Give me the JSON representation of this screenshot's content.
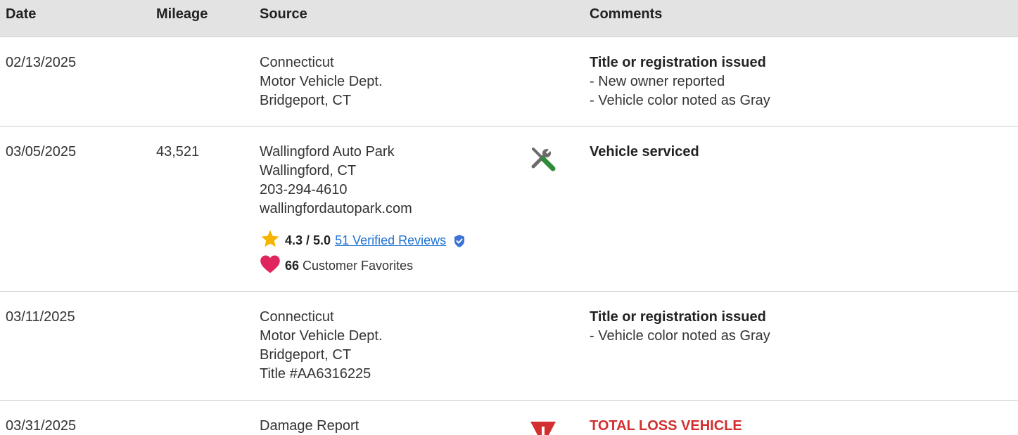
{
  "header": {
    "date": "Date",
    "mileage": "Mileage",
    "source": "Source",
    "comments": "Comments"
  },
  "rows": [
    {
      "date": "02/13/2025",
      "mileage": "",
      "source": [
        "Connecticut",
        "Motor Vehicle Dept.",
        "Bridgeport, CT"
      ],
      "icon": "",
      "comment_title": "Title or registration issued",
      "comment_items": [
        "- New owner reported",
        "- Vehicle color noted as Gray"
      ]
    },
    {
      "date": "03/05/2025",
      "mileage": "43,521",
      "source": [
        "Wallingford Auto Park",
        "Wallingford, CT",
        "203-294-4610",
        "wallingfordautopark.com"
      ],
      "icon": "wrench-screwdriver-icon",
      "comment_title": "Vehicle serviced",
      "comment_items": [],
      "rating": {
        "score": "4.3 / 5.0",
        "reviews_link": "51 Verified Reviews",
        "favorites_count": "66",
        "favorites_label": "Customer Favorites"
      }
    },
    {
      "date": "03/11/2025",
      "mileage": "",
      "source": [
        "Connecticut",
        "Motor Vehicle Dept.",
        "Bridgeport, CT",
        "Title #AA6316225"
      ],
      "icon": "",
      "comment_title": "Title or registration issued",
      "comment_items": [
        "- Vehicle color noted as Gray"
      ]
    },
    {
      "date": "03/31/2025",
      "mileage": "",
      "source": [
        "Damage Report"
      ],
      "icon": "warning-icon",
      "comment_title": "TOTAL LOSS VEHICLE",
      "comment_items": []
    }
  ],
  "colors": {
    "header_bg": "#e3e3e3",
    "link": "#1e73d2",
    "star": "#f4b400",
    "heart": "#e0245e",
    "shield": "#3b73d6",
    "service_green": "#2e8b3a",
    "alert_red": "#d32f2f"
  }
}
